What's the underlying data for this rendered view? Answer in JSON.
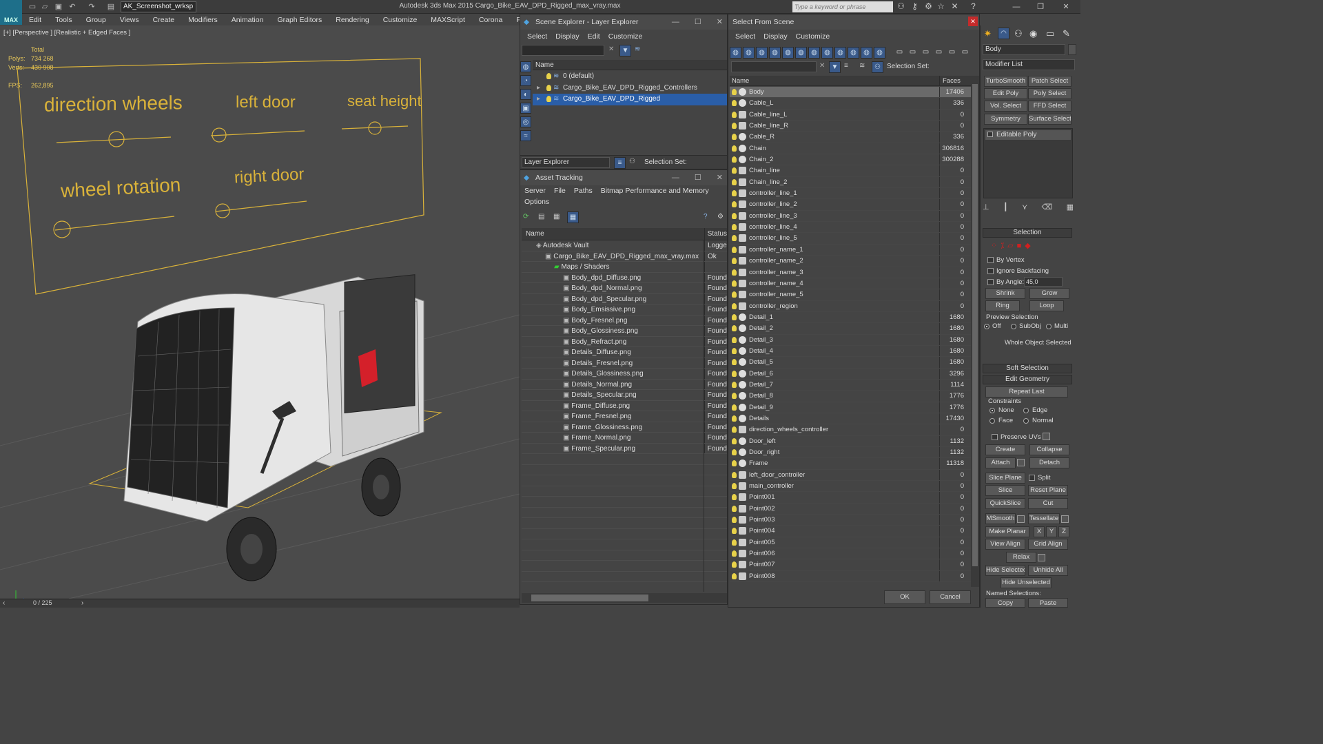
{
  "app": {
    "logo_text": "MAX",
    "workspace": "AK_Screenshot_wrksp",
    "title": "Autodesk 3ds Max  2015     Cargo_Bike_EAV_DPD_Rigged_max_vray.max",
    "search_placeholder": "Type a keyword or phrase"
  },
  "menubar": [
    "Edit",
    "Tools",
    "Group",
    "Views",
    "Create",
    "Modifiers",
    "Animation",
    "Graph Editors",
    "Rendering",
    "Customize",
    "MAXScript",
    "Corona",
    "Project Man"
  ],
  "viewport": {
    "label": "[+] [Perspective ] [Realistic + Edged Faces ]",
    "stats": {
      "total_label": "Total",
      "polys_label": "Polys:",
      "polys_value": "734 268",
      "verts_label": "Verts:",
      "verts_value": "430 908",
      "fps_label": "FPS:",
      "fps_value": "262,895"
    },
    "controls": [
      "direction wheels",
      "left door",
      "seat height",
      "wheel rotation",
      "right door"
    ],
    "colors": {
      "controller": "#d9b23a",
      "bg": "#4b4b4b"
    }
  },
  "timeline": {
    "frame": "0 / 225"
  },
  "scene_explorer": {
    "title": "Scene Explorer - Layer Explorer",
    "menu": [
      "Select",
      "Display",
      "Edit",
      "Customize"
    ],
    "column": "Name",
    "layers": [
      {
        "name": "0 (default)",
        "selected": false
      },
      {
        "name": "Cargo_Bike_EAV_DPD_Rigged_Controllers",
        "selected": false
      },
      {
        "name": "Cargo_Bike_EAV_DPD_Rigged",
        "selected": true
      }
    ],
    "footer_dropdown": "Layer Explorer",
    "selection_set_label": "Selection Set:"
  },
  "asset_tracking": {
    "title": "Asset Tracking",
    "menu": [
      "Server",
      "File",
      "Paths",
      "Bitmap Performance and Memory"
    ],
    "menu2": "Options",
    "col_name": "Name",
    "col_status": "Status",
    "rows": [
      {
        "name": "Autodesk Vault",
        "status": "Logge",
        "indent": 1
      },
      {
        "name": "Cargo_Bike_EAV_DPD_Rigged_max_vray.max",
        "status": "Ok",
        "indent": 2
      },
      {
        "name": "Maps / Shaders",
        "status": "",
        "indent": 3
      },
      {
        "name": "Body_dpd_Diffuse.png",
        "status": "Found",
        "indent": 4
      },
      {
        "name": "Body_dpd_Normal.png",
        "status": "Found",
        "indent": 4
      },
      {
        "name": "Body_dpd_Specular.png",
        "status": "Found",
        "indent": 4
      },
      {
        "name": "Body_Emsissive.png",
        "status": "Found",
        "indent": 4
      },
      {
        "name": "Body_Fresnel.png",
        "status": "Found",
        "indent": 4
      },
      {
        "name": "Body_Glossiness.png",
        "status": "Found",
        "indent": 4
      },
      {
        "name": "Body_Refract.png",
        "status": "Found",
        "indent": 4
      },
      {
        "name": "Details_Diffuse.png",
        "status": "Found",
        "indent": 4
      },
      {
        "name": "Details_Fresnel.png",
        "status": "Found",
        "indent": 4
      },
      {
        "name": "Details_Glossiness.png",
        "status": "Found",
        "indent": 4
      },
      {
        "name": "Details_Normal.png",
        "status": "Found",
        "indent": 4
      },
      {
        "name": "Details_Specular.png",
        "status": "Found",
        "indent": 4
      },
      {
        "name": "Frame_Diffuse.png",
        "status": "Found",
        "indent": 4
      },
      {
        "name": "Frame_Fresnel.png",
        "status": "Found",
        "indent": 4
      },
      {
        "name": "Frame_Glossiness.png",
        "status": "Found",
        "indent": 4
      },
      {
        "name": "Frame_Normal.png",
        "status": "Found",
        "indent": 4
      },
      {
        "name": "Frame_Specular.png",
        "status": "Found",
        "indent": 4
      }
    ]
  },
  "select_from_scene": {
    "title": "Select From Scene",
    "menu": [
      "Select",
      "Display",
      "Customize"
    ],
    "selection_set_label": "Selection Set:",
    "col_name": "Name",
    "col_faces": "Faces",
    "rows": [
      {
        "name": "Body",
        "faces": "17406",
        "type": "geo",
        "selected": true
      },
      {
        "name": "Cable_L",
        "faces": "336",
        "type": "geo"
      },
      {
        "name": "Cable_line_L",
        "faces": "0",
        "type": "shape"
      },
      {
        "name": "Cable_line_R",
        "faces": "0",
        "type": "shape"
      },
      {
        "name": "Cable_R",
        "faces": "336",
        "type": "geo"
      },
      {
        "name": "Chain",
        "faces": "306816",
        "type": "geo"
      },
      {
        "name": "Chain_2",
        "faces": "300288",
        "type": "geo"
      },
      {
        "name": "Chain_line",
        "faces": "0",
        "type": "shape"
      },
      {
        "name": "Chain_line_2",
        "faces": "0",
        "type": "shape"
      },
      {
        "name": "controller_line_1",
        "faces": "0",
        "type": "shape"
      },
      {
        "name": "controller_line_2",
        "faces": "0",
        "type": "shape"
      },
      {
        "name": "controller_line_3",
        "faces": "0",
        "type": "shape"
      },
      {
        "name": "controller_line_4",
        "faces": "0",
        "type": "shape"
      },
      {
        "name": "controller_line_5",
        "faces": "0",
        "type": "shape"
      },
      {
        "name": "controller_name_1",
        "faces": "0",
        "type": "shape"
      },
      {
        "name": "controller_name_2",
        "faces": "0",
        "type": "shape"
      },
      {
        "name": "controller_name_3",
        "faces": "0",
        "type": "shape"
      },
      {
        "name": "controller_name_4",
        "faces": "0",
        "type": "shape"
      },
      {
        "name": "controller_name_5",
        "faces": "0",
        "type": "shape"
      },
      {
        "name": "controller_region",
        "faces": "0",
        "type": "shape"
      },
      {
        "name": "Detail_1",
        "faces": "1680",
        "type": "geo"
      },
      {
        "name": "Detail_2",
        "faces": "1680",
        "type": "geo"
      },
      {
        "name": "Detail_3",
        "faces": "1680",
        "type": "geo"
      },
      {
        "name": "Detail_4",
        "faces": "1680",
        "type": "geo"
      },
      {
        "name": "Detail_5",
        "faces": "1680",
        "type": "geo"
      },
      {
        "name": "Detail_6",
        "faces": "3296",
        "type": "geo"
      },
      {
        "name": "Detail_7",
        "faces": "1114",
        "type": "geo"
      },
      {
        "name": "Detail_8",
        "faces": "1776",
        "type": "geo"
      },
      {
        "name": "Detail_9",
        "faces": "1776",
        "type": "geo"
      },
      {
        "name": "Details",
        "faces": "17430",
        "type": "geo"
      },
      {
        "name": "direction_wheels_controller",
        "faces": "0",
        "type": "shape"
      },
      {
        "name": "Door_left",
        "faces": "1132",
        "type": "geo"
      },
      {
        "name": "Door_right",
        "faces": "1132",
        "type": "geo"
      },
      {
        "name": "Frame",
        "faces": "11318",
        "type": "geo"
      },
      {
        "name": "left_door_controller",
        "faces": "0",
        "type": "shape"
      },
      {
        "name": "main_controller",
        "faces": "0",
        "type": "shape"
      },
      {
        "name": "Point001",
        "faces": "0",
        "type": "helper"
      },
      {
        "name": "Point002",
        "faces": "0",
        "type": "helper"
      },
      {
        "name": "Point003",
        "faces": "0",
        "type": "helper"
      },
      {
        "name": "Point004",
        "faces": "0",
        "type": "helper"
      },
      {
        "name": "Point005",
        "faces": "0",
        "type": "helper"
      },
      {
        "name": "Point006",
        "faces": "0",
        "type": "helper"
      },
      {
        "name": "Point007",
        "faces": "0",
        "type": "helper"
      },
      {
        "name": "Point008",
        "faces": "0",
        "type": "helper"
      }
    ],
    "ok": "OK",
    "cancel": "Cancel"
  },
  "command_panel": {
    "object_name": "Body",
    "modifier_list": "Modifier List",
    "mod_buttons": [
      "TurboSmooth",
      "Patch Select",
      "Edit Poly",
      "Poly Select",
      "Vol. Select",
      "FFD Select",
      "Symmetry",
      "Surface Select"
    ],
    "stack_item": "Editable Poly",
    "selection_title": "Selection",
    "by_vertex": "By Vertex",
    "ignore_backfacing": "Ignore Backfacing",
    "by_angle": "By Angle:",
    "angle_value": "45,0",
    "shrink": "Shrink",
    "grow": "Grow",
    "ring": "Ring",
    "loop": "Loop",
    "preview_selection": "Preview Selection",
    "preview_opts": [
      "Off",
      "SubObj",
      "Multi"
    ],
    "whole_object": "Whole Object Selected",
    "soft_selection": "Soft Selection",
    "edit_geometry": "Edit Geometry",
    "repeat_last": "Repeat Last",
    "constraints": "Constraints",
    "constraint_opts": [
      "None",
      "Edge",
      "Face",
      "Normal"
    ],
    "preserve_uvs": "Preserve UVs",
    "create": "Create",
    "collapse": "Collapse",
    "attach": "Attach",
    "detach": "Detach",
    "slice_plane": "Slice Plane",
    "split": "Split",
    "slice": "Slice",
    "reset_plane": "Reset Plane",
    "quickslice": "QuickSlice",
    "cut": "Cut",
    "msmooth": "MSmooth",
    "tessellate": "Tessellate",
    "make_planar": "Make Planar",
    "x": "X",
    "y": "Y",
    "z": "Z",
    "view_align": "View Align",
    "grid_align": "Grid Align",
    "relax": "Relax",
    "hide_selected": "Hide Selected",
    "unhide_all": "Unhide All",
    "hide_unselected": "Hide Unselected",
    "named_selections": "Named Selections:",
    "copy": "Copy",
    "paste": "Paste"
  }
}
